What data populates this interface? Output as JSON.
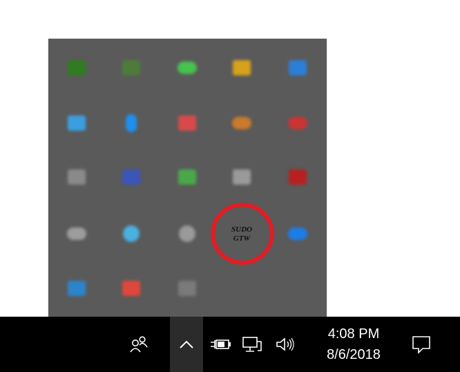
{
  "tray_popup": {
    "icons": [
      {
        "name": "nvidia-icon",
        "color": "#2f7d1f",
        "shape": "sq"
      },
      {
        "name": "green-app-icon",
        "color": "#4d7c3a",
        "shape": "sq"
      },
      {
        "name": "chat-app-icon",
        "color": "#46c24f",
        "shape": "round"
      },
      {
        "name": "colorful-app-icon",
        "color": "#d6a21c",
        "shape": "sq"
      },
      {
        "name": "blue-app-icon",
        "color": "#2b7fd6",
        "shape": "sq"
      },
      {
        "name": "blue-window-icon",
        "color": "#3a9fe0",
        "shape": "sq"
      },
      {
        "name": "bluetooth-icon",
        "color": "#1e8ff0",
        "shape": "pill"
      },
      {
        "name": "red-white-app-icon",
        "color": "#d84a4a",
        "shape": "sq"
      },
      {
        "name": "orange-app-icon",
        "color": "#c97a2a",
        "shape": "round"
      },
      {
        "name": "cloud-red-icon",
        "color": "#cc3333",
        "shape": "round"
      },
      {
        "name": "grey-app-icon",
        "color": "#8a8a8a",
        "shape": "sq"
      },
      {
        "name": "monitor-app-icon",
        "color": "#3a56b8",
        "shape": "sq"
      },
      {
        "name": "network-app-icon",
        "color": "#4aa84a",
        "shape": "sq"
      },
      {
        "name": "document-app-icon",
        "color": "#9a9a9a",
        "shape": "sq"
      },
      {
        "name": "red-alarm-icon",
        "color": "#b82020",
        "shape": "sq"
      },
      {
        "name": "onedrive-icon",
        "color": "#9d9d9d",
        "shape": "round"
      },
      {
        "name": "globe-app-icon",
        "color": "#4ab0e0",
        "shape": "circ"
      },
      {
        "name": "settings-circle-icon",
        "color": "#9a9a9a",
        "shape": "circ"
      },
      {
        "name": "sudo-gtw-icon",
        "color": "",
        "shape": "text"
      },
      {
        "name": "zoom-icon",
        "color": "#1d7de8",
        "shape": "round"
      },
      {
        "name": "dropbox-app-icon",
        "color": "#2c85cc",
        "shape": "sq"
      },
      {
        "name": "s-app-icon",
        "color": "#e0473c",
        "shape": "sq"
      },
      {
        "name": "grey-glyph-icon",
        "color": "#7a7a7a",
        "shape": "sq"
      }
    ],
    "sudo_icon": {
      "line1": "SUDO",
      "line2": "GTW"
    }
  },
  "taskbar": {
    "time": "4:08 PM",
    "date": "8/6/2018"
  },
  "colors": {
    "popup_bg": "#5a5a5a",
    "taskbar_bg": "#000000",
    "annotation": "#e01e24"
  }
}
